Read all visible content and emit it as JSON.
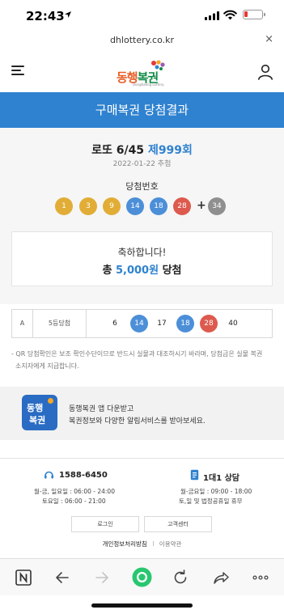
{
  "status_bar": {
    "time": "22:43"
  },
  "browser": {
    "url": "dhlottery.co.kr",
    "close_symbol": "×"
  },
  "site": {
    "logo_text_orange": "동행",
    "logo_text_green": "복권",
    "logo_subtext": "Donghaeng Lottery"
  },
  "banner": {
    "title": "구매복권 당첨결과"
  },
  "result": {
    "game_name": "로또 6/45",
    "draw": "제999회",
    "date": "2022-01-22 추첨",
    "winning_label": "당첨번호",
    "numbers": [
      {
        "value": "1",
        "color": "#e1ad36"
      },
      {
        "value": "3",
        "color": "#e1ad36"
      },
      {
        "value": "9",
        "color": "#e1ad36"
      },
      {
        "value": "14",
        "color": "#4c8fd8"
      },
      {
        "value": "18",
        "color": "#4c8fd8"
      },
      {
        "value": "28",
        "color": "#dd5a4e"
      }
    ],
    "plus": "+",
    "bonus": {
      "value": "34",
      "color": "#8f8f8f"
    }
  },
  "congrats": {
    "line1": "축하합니다!",
    "prefix": "총",
    "amount": "5,000원",
    "suffix": "당첨"
  },
  "my_ticket": {
    "slot": "A",
    "rank": "5등당첨",
    "numbers": [
      {
        "value": "6",
        "hit": false,
        "color": ""
      },
      {
        "value": "14",
        "hit": true,
        "color": "#4c8fd8"
      },
      {
        "value": "17",
        "hit": false,
        "color": ""
      },
      {
        "value": "18",
        "hit": true,
        "color": "#4c8fd8"
      },
      {
        "value": "28",
        "hit": true,
        "color": "#dd5a4e"
      },
      {
        "value": "40",
        "hit": false,
        "color": ""
      }
    ]
  },
  "notice": {
    "line1": "- QR 당첨확인은 보조 확인수단이므로 반드시 실물과 대조하시기 바라며, 당첨금은 실물 복권",
    "line2": "소지자에게 지급합니다."
  },
  "promo": {
    "icon_line1": "동행",
    "icon_line2": "복권",
    "line1": "동행복권 앱 다운받고",
    "line2": "복권정보와 다양한 알림서비스를 받아보세요."
  },
  "contact": {
    "phone": "1588-6450",
    "phone_hours1": "월-금, 일요일 : 06:00 - 24:00",
    "phone_hours2": "토요일 : 06:00 - 21:00",
    "chat": "1대1 상담",
    "chat_hours1": "월-금요일 : 09:00 - 18:00",
    "chat_hours2": "토,일 및 법정공휴일 휴무",
    "login_button": "로그인",
    "support_button": "고객센터",
    "privacy_link": "개인정보처리방침",
    "separator": "I",
    "terms_link": "이용약관"
  },
  "colors": {
    "accent": "#2f82cf",
    "brand_orange": "#e85d25",
    "brand_green": "#0f8b45",
    "app_green": "#28c76f"
  },
  "toolbar": {
    "icons": [
      "naver-n-icon",
      "back-arrow-icon",
      "forward-arrow-icon",
      "home-circle-icon",
      "reload-icon",
      "share-icon",
      "more-icon"
    ]
  }
}
